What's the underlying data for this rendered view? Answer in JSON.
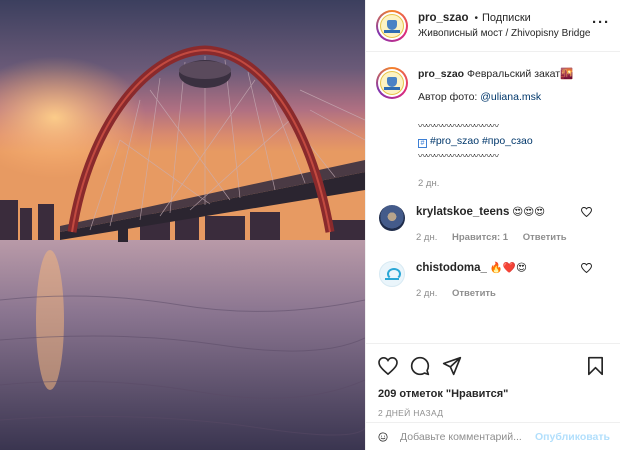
{
  "post": {
    "username": "pro_szao",
    "follow_status": "Подписки",
    "location": "Живописный мост / Zhivopisny Bridge",
    "more_icon": "more-horizontal-icon"
  },
  "caption": {
    "username": "pro_szao",
    "text": "Февральский закат",
    "emoji": "🌇",
    "author_prefix": "Автор фото: ",
    "author_link": "@uliana.msk",
    "divider": "〰〰〰〰〰〰〰〰〰〰",
    "hashtags": "#pro_szao #про_сзао",
    "hashtag_box_icon": "hashtag-box-icon",
    "time": "2 дн."
  },
  "comments": [
    {
      "username": "krylatskoe_teens",
      "text": "😍😍😍",
      "time": "2 дн.",
      "likes_label": "Нравится: 1",
      "reply_label": "Ответить"
    },
    {
      "username": "chistodoma_",
      "text": "🔥❤️😍",
      "time": "2 дн.",
      "reply_label": "Ответить"
    }
  ],
  "actions": {
    "likes_text": "209 отметок \"Нравится\"",
    "date_text": "2 ДНЕЙ НАЗАД"
  },
  "add_comment": {
    "placeholder": "Добавьте комментарий...",
    "publish_label": "Опубликовать"
  },
  "colors": {
    "link": "#00376b",
    "muted": "#8e8e8e",
    "publish_disabled": "#b2dffc",
    "bridge_arch": "#8a2a2c"
  }
}
